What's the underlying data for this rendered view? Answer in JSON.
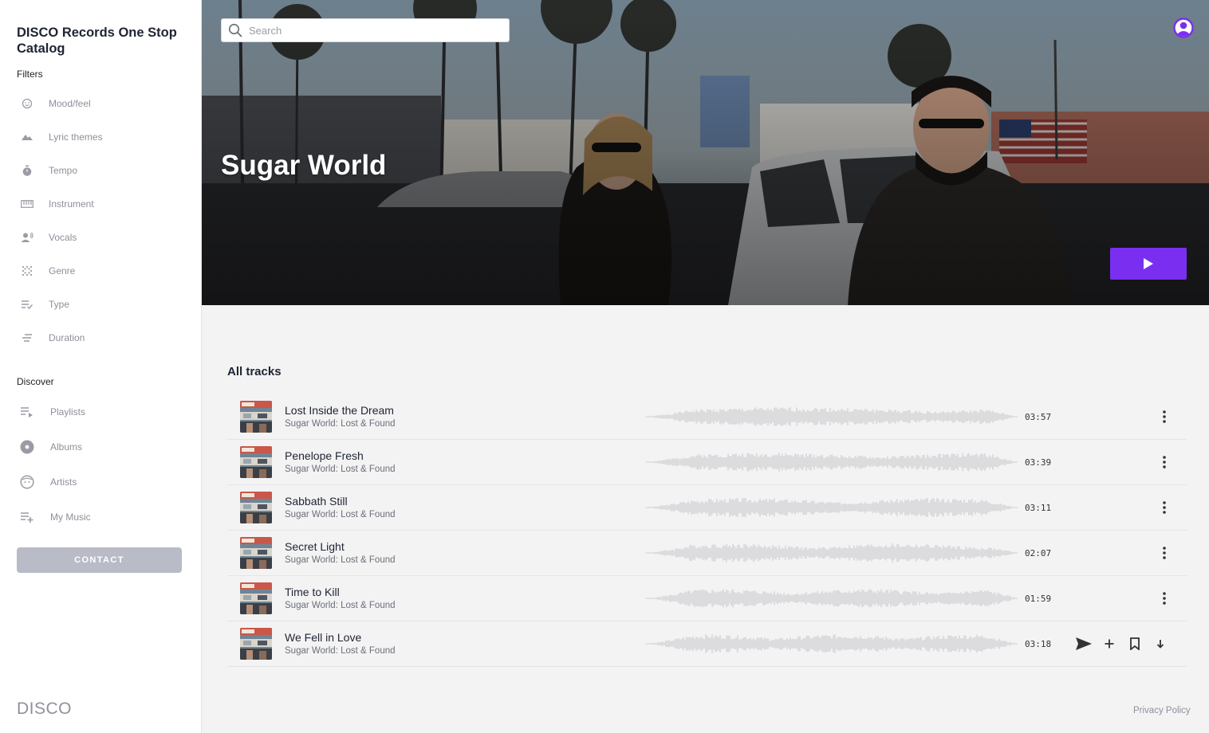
{
  "sidebar": {
    "brand": "DISCO Records One Stop Catalog",
    "filters_label": "Filters",
    "filters": [
      {
        "label": "Mood/feel",
        "icon": "smiley-icon"
      },
      {
        "label": "Lyric themes",
        "icon": "mountains-icon"
      },
      {
        "label": "Tempo",
        "icon": "stopwatch-icon"
      },
      {
        "label": "Instrument",
        "icon": "keyboard-icon"
      },
      {
        "label": "Vocals",
        "icon": "singer-icon"
      },
      {
        "label": "Genre",
        "icon": "dots-grid-icon"
      },
      {
        "label": "Type",
        "icon": "list-check-icon"
      },
      {
        "label": "Duration",
        "icon": "lines-icon"
      }
    ],
    "discover_label": "Discover",
    "discover": [
      {
        "label": "Playlists",
        "icon": "playlist-icon"
      },
      {
        "label": "Albums",
        "icon": "album-disc-icon"
      },
      {
        "label": "Artists",
        "icon": "face-icon"
      },
      {
        "label": "My Music",
        "icon": "playlist-add-icon"
      }
    ],
    "contact_label": "CONTACT",
    "logo": "DISCO"
  },
  "header": {
    "search_placeholder": "Search",
    "hero_title": "Sugar World"
  },
  "tracks": {
    "heading": "All tracks",
    "items": [
      {
        "title": "Lost Inside the Dream",
        "album": "Sugar World: Lost & Found",
        "duration": "03:57"
      },
      {
        "title": "Penelope Fresh",
        "album": "Sugar World: Lost & Found",
        "duration": "03:39"
      },
      {
        "title": "Sabbath Still",
        "album": "Sugar World: Lost & Found",
        "duration": "03:11"
      },
      {
        "title": "Secret Light",
        "album": "Sugar World: Lost & Found",
        "duration": "02:07"
      },
      {
        "title": "Time to Kill",
        "album": "Sugar World: Lost & Found",
        "duration": "01:59"
      },
      {
        "title": "We Fell in Love",
        "album": "Sugar World: Lost & Found",
        "duration": "03:18"
      }
    ]
  },
  "footer": {
    "privacy": "Privacy Policy"
  },
  "colors": {
    "accent": "#7a2ff0",
    "contact_bg": "#b9bcc6",
    "waveform": "#c4c4c8",
    "sidebar_text": "#8d909a"
  }
}
